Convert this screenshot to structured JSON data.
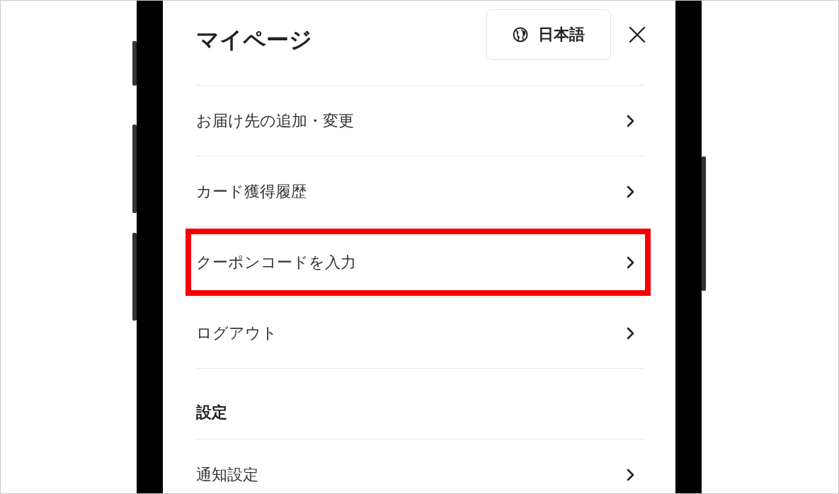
{
  "header": {
    "title": "マイページ",
    "language_button": "日本語"
  },
  "items": [
    {
      "label": "お届け先の追加・変更",
      "highlighted": false
    },
    {
      "label": "カード獲得履歴",
      "highlighted": false
    },
    {
      "label": "クーポンコードを入力",
      "highlighted": true
    },
    {
      "label": "ログアウト",
      "highlighted": false
    }
  ],
  "sections": [
    {
      "title": "設定",
      "items": [
        {
          "label": "通知設定",
          "highlighted": false
        }
      ]
    }
  ]
}
